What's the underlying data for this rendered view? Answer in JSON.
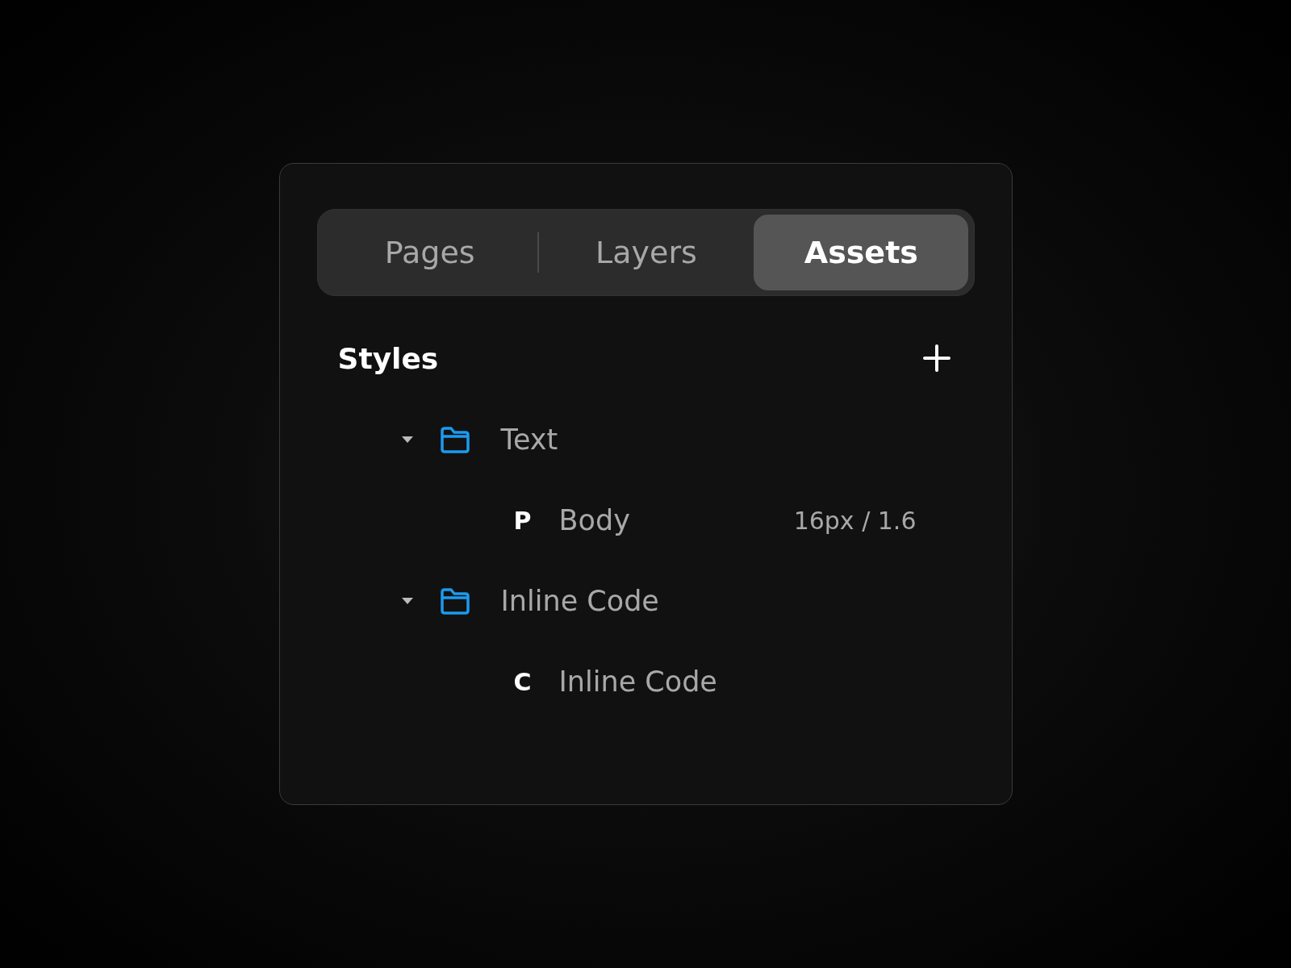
{
  "tabs": [
    {
      "label": "Pages",
      "selected": false
    },
    {
      "label": "Layers",
      "selected": false
    },
    {
      "label": "Assets",
      "selected": true
    }
  ],
  "styles": {
    "title": "Styles",
    "tree": [
      {
        "label": "Text",
        "expanded": true,
        "children": [
          {
            "letter": "P",
            "label": "Body",
            "detail": "16px / 1.6"
          }
        ]
      },
      {
        "label": "Inline Code",
        "expanded": true,
        "children": [
          {
            "letter": "C",
            "label": "Inline Code"
          }
        ]
      }
    ]
  }
}
